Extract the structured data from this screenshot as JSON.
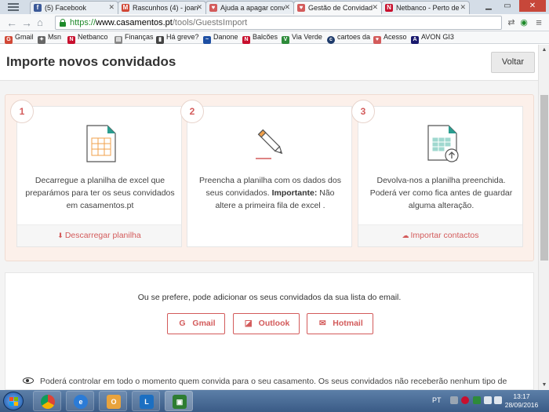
{
  "browser": {
    "tabs": [
      {
        "title": "(5) Facebook",
        "color": "#3b5998",
        "glyph": "f"
      },
      {
        "title": "Rascunhos (4) - joan",
        "color": "#d14836",
        "glyph": "M"
      },
      {
        "title": "Ajuda a apagar conv",
        "color": "#d35b5b",
        "glyph": "♥"
      },
      {
        "title": "Gestão de Convidad",
        "color": "#d35b5b",
        "glyph": "♥",
        "active": true
      },
      {
        "title": "Netbanco - Perto de",
        "color": "#c8102e",
        "glyph": "N"
      }
    ],
    "url": {
      "scheme": "https://",
      "host": "www.casamentos.pt",
      "path": "/tools/GuestsImport"
    },
    "bookmarks": [
      {
        "label": "Gmail",
        "color": "#d14836",
        "glyph": "G"
      },
      {
        "label": "Msn",
        "color": "#666666",
        "glyph": "✦"
      },
      {
        "label": "Netbanco",
        "color": "#c8102e",
        "glyph": "N"
      },
      {
        "label": "Finanças",
        "color": "#888888",
        "glyph": "▤"
      },
      {
        "label": "Há greve?",
        "color": "#444444",
        "glyph": "▮"
      },
      {
        "label": "Danone",
        "color": "#1e4fa3",
        "glyph": "~"
      },
      {
        "label": "Balcões",
        "color": "#c8102e",
        "glyph": "N"
      },
      {
        "label": "Via Verde",
        "color": "#2e8b3a",
        "glyph": "V"
      },
      {
        "label": "cartoes da",
        "color": "#1d3a6b",
        "glyph": "c"
      },
      {
        "label": "Acesso",
        "color": "#d35b5b",
        "glyph": "♥"
      },
      {
        "label": "AVON GI3",
        "color": "#1a1a6e",
        "glyph": "A"
      }
    ]
  },
  "page": {
    "title": "Importe novos convidados",
    "back_label": "Voltar",
    "steps": [
      {
        "number": "1",
        "text": "Decarregue a planilha de excel que preparámos para ter os seus convidados em casamentos.pt",
        "text_bold": "",
        "text_after": "",
        "action": "Descarregar planilha",
        "action_icon": "download-icon"
      },
      {
        "number": "2",
        "text": "Preencha a planilha com os dados dos seus convidados. ",
        "text_bold": "Importante:",
        "text_after": " Não altere a primeira fila de excel .",
        "action": "",
        "action_icon": ""
      },
      {
        "number": "3",
        "text": "Devolva-nos a planilha preenchida. Poderá ver como fica antes de guardar alguma alteração.",
        "text_bold": "",
        "text_after": "",
        "action": "Importar contactos",
        "action_icon": "cloud-upload-icon"
      }
    ],
    "email_prompt": "Ou se prefere, pode adicionar os seus convidados da sua lista do email.",
    "providers": [
      {
        "label": "Gmail",
        "icon": "google-icon"
      },
      {
        "label": "Outlook",
        "icon": "outlook-icon"
      },
      {
        "label": "Hotmail",
        "icon": "envelope-icon"
      }
    ],
    "privacy_text": "Poderá controlar em todo o momento quem convida para o seu casamento. Os seus convidados não receberão nenhum tipo de"
  },
  "taskbar": {
    "language": "PT",
    "time": "13:17",
    "date": "28/09/2016"
  },
  "colors": {
    "accent": "#d35b5b",
    "panel_bg": "#fcf0ea"
  }
}
